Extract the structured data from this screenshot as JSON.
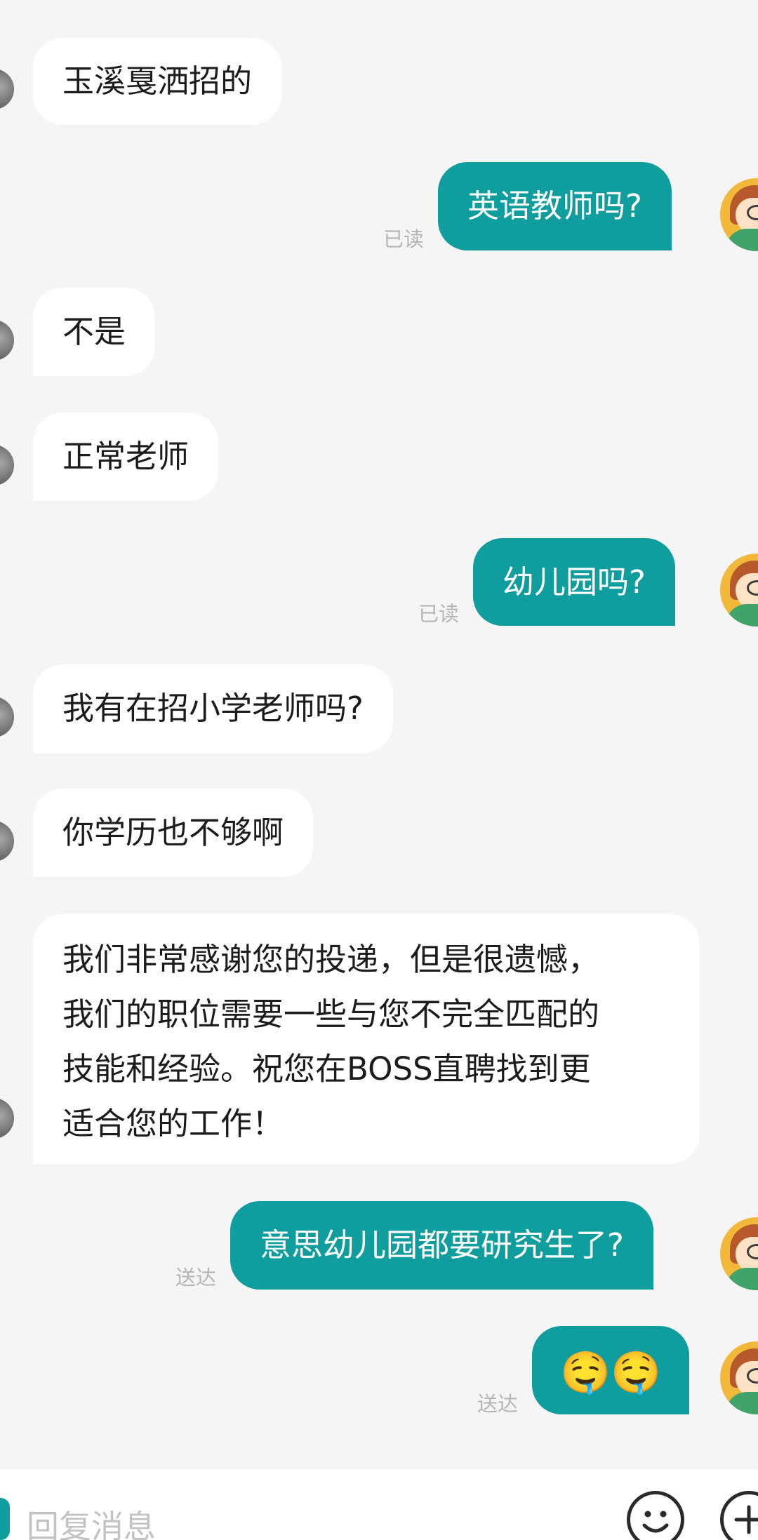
{
  "messages": [
    {
      "side": "in",
      "text": "玉溪戛洒招的"
    },
    {
      "side": "out",
      "text": "英语教师吗?",
      "status": "已读"
    },
    {
      "side": "in",
      "text": "不是"
    },
    {
      "side": "in",
      "text": "正常老师"
    },
    {
      "side": "out",
      "text": "幼儿园吗?",
      "status": "已读"
    },
    {
      "side": "in",
      "text": "我有在招小学老师吗?"
    },
    {
      "side": "in",
      "text": "你学历也不够啊"
    },
    {
      "side": "in",
      "lines": [
        "我们非常感谢您的投递，但是很遗憾，",
        "我们的职位需要一些与您不完全匹配的",
        "技能和经验。祝您在BOSS直聘找到更",
        "适合您的工作！"
      ]
    },
    {
      "side": "out",
      "text": "意思幼儿园都要研究生了?",
      "status": "送达"
    },
    {
      "side": "out",
      "emoji": "🤤🤤",
      "status": "送达"
    }
  ],
  "input": {
    "placeholder": "回复消息",
    "emoji_icon": "smiley-face-icon",
    "plus_icon": "plus-icon"
  },
  "colors": {
    "background": "#f5f5f5",
    "outgoing_bubble": "#109d9d",
    "incoming_bubble": "#ffffff",
    "status_text": "#b5b5b5"
  }
}
